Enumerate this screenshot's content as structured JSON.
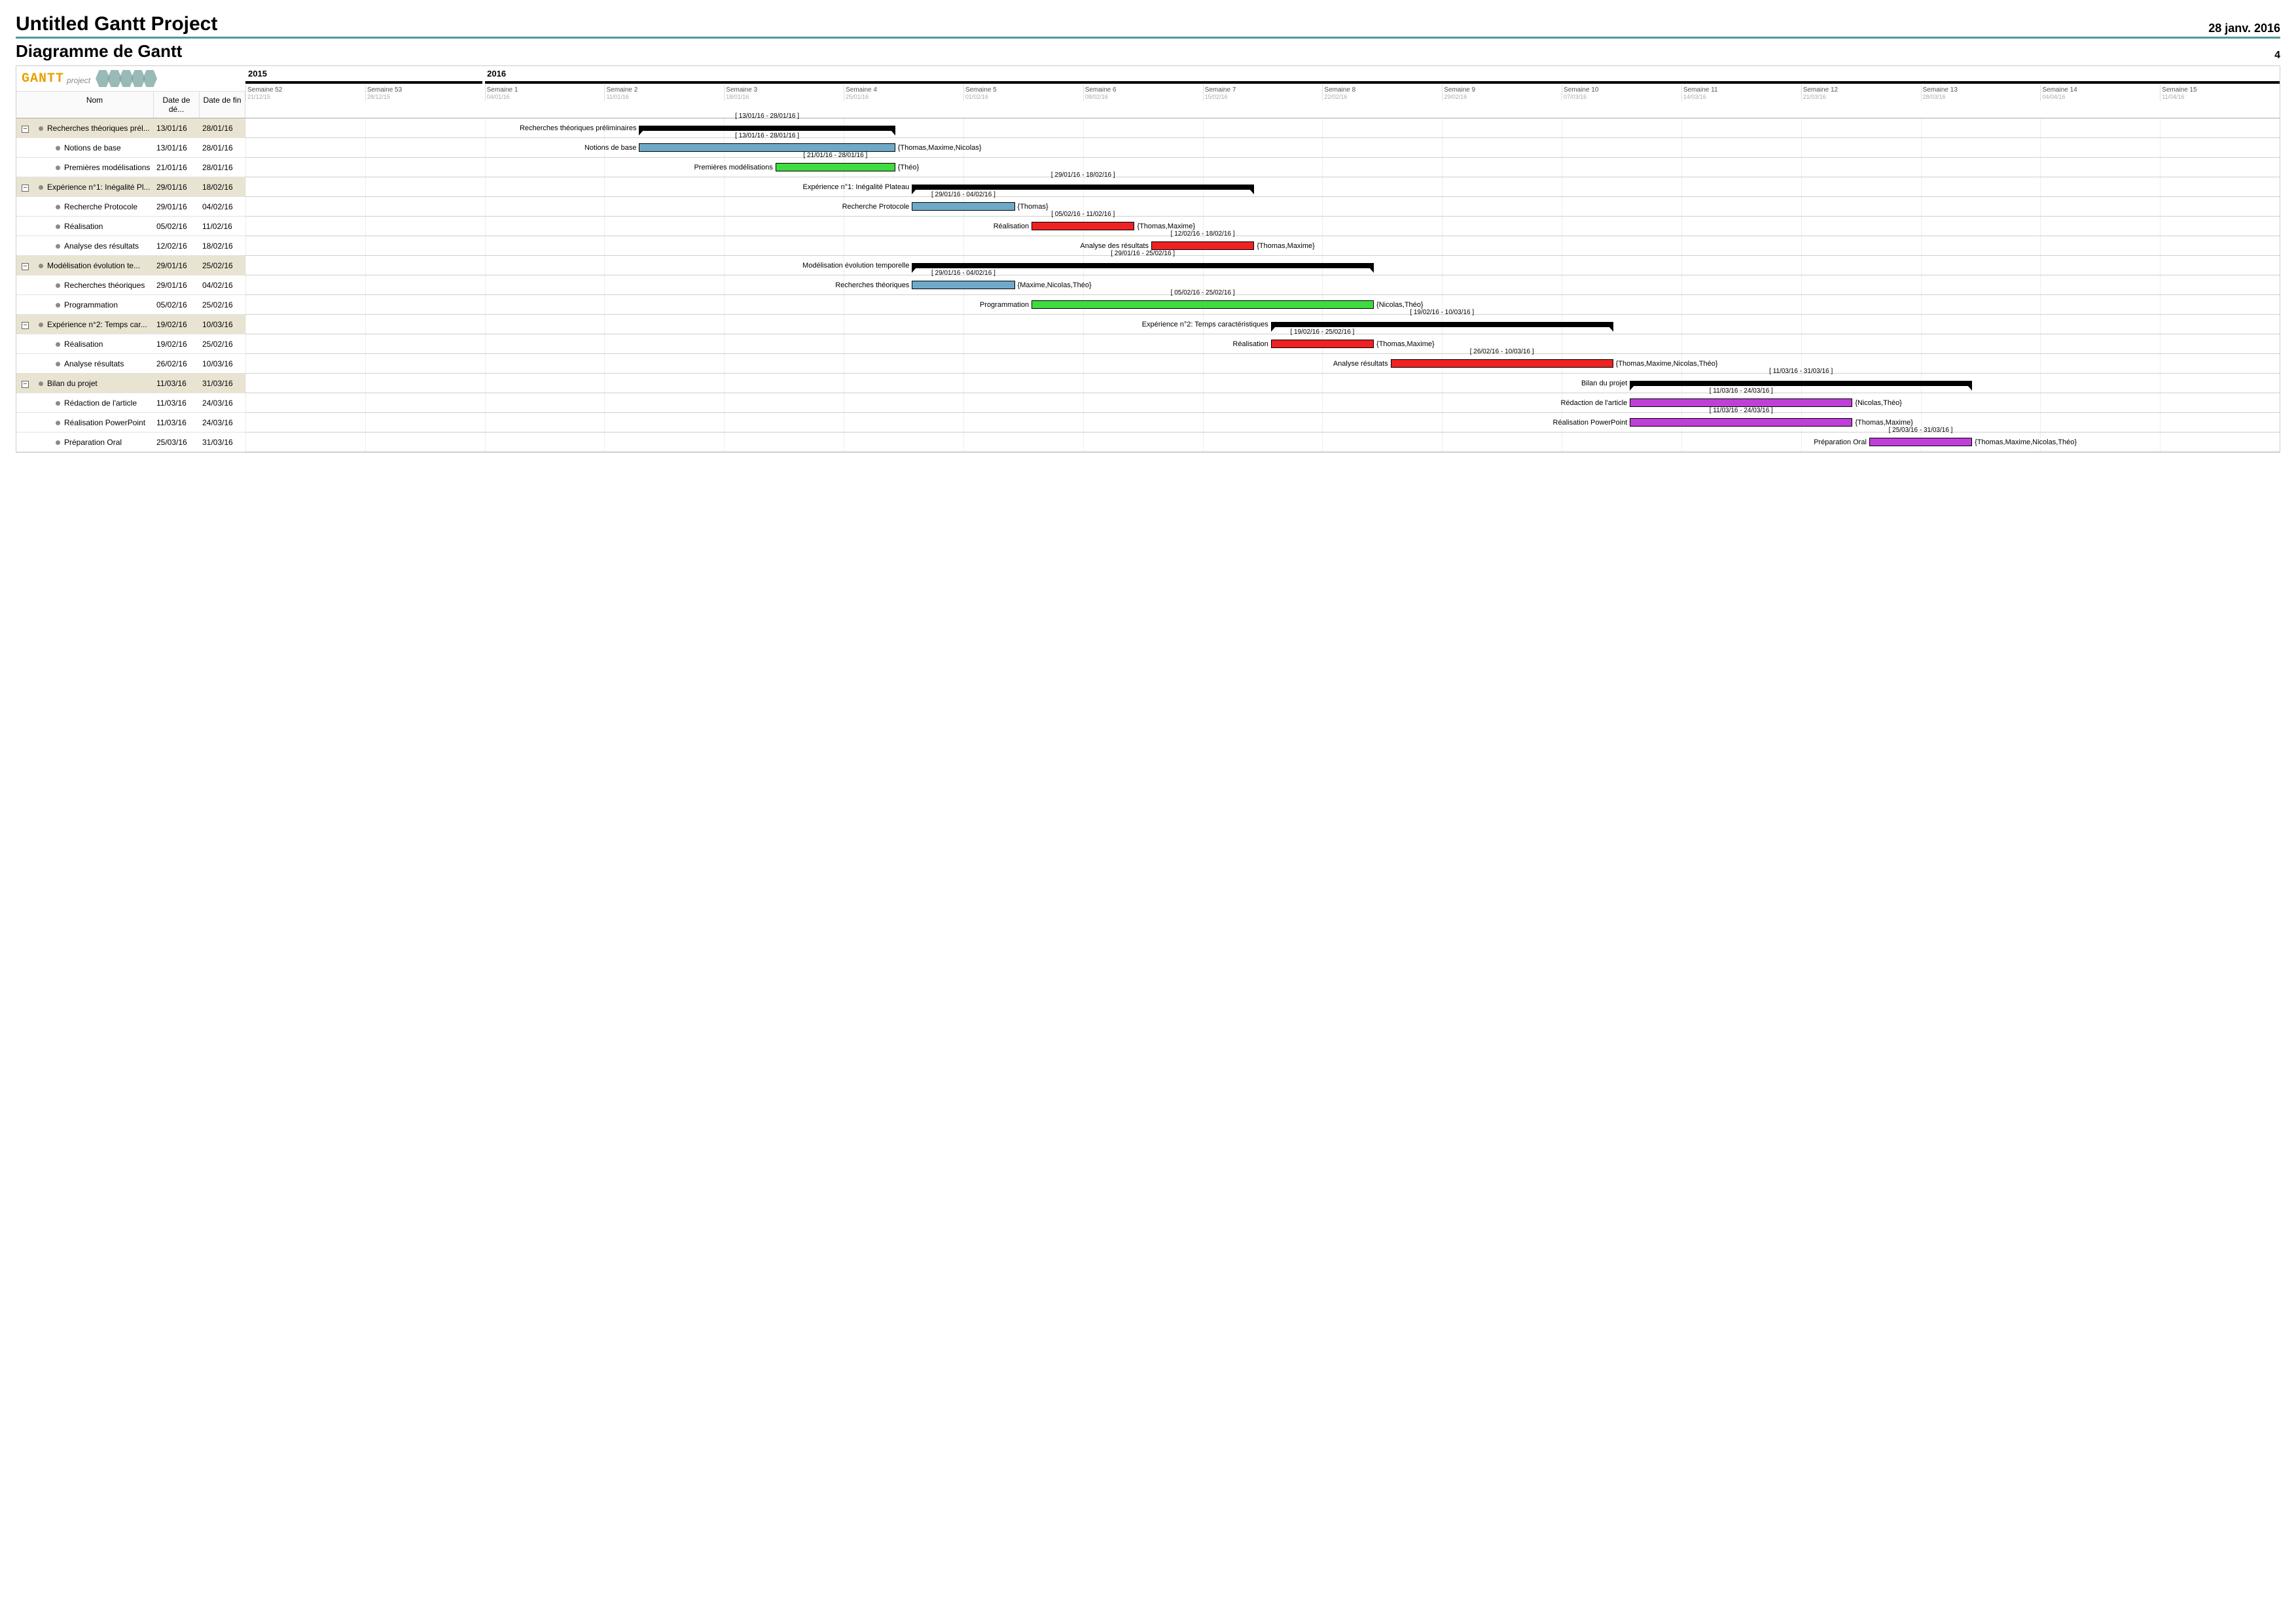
{
  "project_title": "Untitled Gantt Project",
  "project_date": "28 janv. 2016",
  "chart_title": "Diagramme de Gantt",
  "page_number": "4",
  "logo": {
    "text": "GANTT",
    "sub": "project"
  },
  "columns": {
    "name": "Nom",
    "start": "Date de dé...",
    "end": "Date de fin"
  },
  "years": {
    "y1": "2015",
    "y2": "2016"
  },
  "weeks": [
    {
      "label": "Semaine 52",
      "date": "21/12/15"
    },
    {
      "label": "Semaine 53",
      "date": "28/12/15"
    },
    {
      "label": "Semaine 1",
      "date": "04/01/16"
    },
    {
      "label": "Semaine 2",
      "date": "11/01/16"
    },
    {
      "label": "Semaine 3",
      "date": "18/01/16"
    },
    {
      "label": "Semaine 4",
      "date": "25/01/16"
    },
    {
      "label": "Semaine 5",
      "date": "01/02/16"
    },
    {
      "label": "Semaine 6",
      "date": "08/02/16"
    },
    {
      "label": "Semaine 7",
      "date": "15/02/16"
    },
    {
      "label": "Semaine 8",
      "date": "22/02/16"
    },
    {
      "label": "Semaine 9",
      "date": "29/02/16"
    },
    {
      "label": "Semaine 10",
      "date": "07/03/16"
    },
    {
      "label": "Semaine 11",
      "date": "14/03/16"
    },
    {
      "label": "Semaine 12",
      "date": "21/03/16"
    },
    {
      "label": "Semaine 13",
      "date": "28/03/16"
    },
    {
      "label": "Semaine 14",
      "date": "04/04/16"
    },
    {
      "label": "Semaine 15",
      "date": "11/04/16"
    }
  ],
  "tasks": [
    {
      "name_trunc": "Recherches théoriques prél...",
      "name_full": "Recherches théoriques préliminaires",
      "start": "13/01/16",
      "end": "28/01/16",
      "type": "group",
      "color": "",
      "start_idx": 3.29,
      "dur": 2.14,
      "res": ""
    },
    {
      "name_trunc": "Notions de base",
      "name_full": "Notions de base",
      "start": "13/01/16",
      "end": "28/01/16",
      "type": "child",
      "color": "blue",
      "start_idx": 3.29,
      "dur": 2.14,
      "res": "{Thomas,Maxime,Nicolas}"
    },
    {
      "name_trunc": "Premières modélisations",
      "name_full": "Premières modélisations",
      "start": "21/01/16",
      "end": "28/01/16",
      "type": "child",
      "color": "green",
      "start_idx": 4.43,
      "dur": 1.0,
      "res": "{Théo}"
    },
    {
      "name_trunc": "Expérience n°1: Inégalité Pl...",
      "name_full": "Expérience n°1: Inégalité Plateau",
      "start": "29/01/16",
      "end": "18/02/16",
      "type": "group",
      "color": "",
      "start_idx": 5.57,
      "dur": 2.86,
      "res": ""
    },
    {
      "name_trunc": "Recherche Protocole",
      "name_full": "Recherche Protocole",
      "start": "29/01/16",
      "end": "04/02/16",
      "type": "child",
      "color": "blue",
      "start_idx": 5.57,
      "dur": 0.86,
      "res": "{Thomas}"
    },
    {
      "name_trunc": "Réalisation",
      "name_full": "Réalisation",
      "start": "05/02/16",
      "end": "11/02/16",
      "type": "child",
      "color": "red",
      "start_idx": 6.57,
      "dur": 0.86,
      "res": "{Thomas,Maxime}"
    },
    {
      "name_trunc": "Analyse des résultats",
      "name_full": "Analyse des résultats",
      "start": "12/02/16",
      "end": "18/02/16",
      "type": "child",
      "color": "red",
      "start_idx": 7.57,
      "dur": 0.86,
      "res": "{Thomas,Maxime}"
    },
    {
      "name_trunc": "Modélisation évolution te...",
      "name_full": "Modélisation évolution temporelle",
      "start": "29/01/16",
      "end": "25/02/16",
      "type": "group",
      "color": "",
      "start_idx": 5.57,
      "dur": 3.86,
      "res": ""
    },
    {
      "name_trunc": "Recherches théoriques",
      "name_full": "Recherches théoriques",
      "start": "29/01/16",
      "end": "04/02/16",
      "type": "child",
      "color": "blue",
      "start_idx": 5.57,
      "dur": 0.86,
      "res": "{Maxime,Nicolas,Théo}"
    },
    {
      "name_trunc": "Programmation",
      "name_full": "Programmation",
      "start": "05/02/16",
      "end": "25/02/16",
      "type": "child",
      "color": "green",
      "start_idx": 6.57,
      "dur": 2.86,
      "res": "{Nicolas,Théo}"
    },
    {
      "name_trunc": "Expérience n°2: Temps car...",
      "name_full": "Expérience n°2: Temps caractéristiques",
      "start": "19/02/16",
      "end": "10/03/16",
      "type": "group",
      "color": "",
      "start_idx": 8.57,
      "dur": 2.86,
      "res": ""
    },
    {
      "name_trunc": "Réalisation",
      "name_full": "Réalisation",
      "start": "19/02/16",
      "end": "25/02/16",
      "type": "child",
      "color": "red",
      "start_idx": 8.57,
      "dur": 0.86,
      "res": "{Thomas,Maxime}"
    },
    {
      "name_trunc": "Analyse résultats",
      "name_full": "Analyse résultats",
      "start": "26/02/16",
      "end": "10/03/16",
      "type": "child",
      "color": "red",
      "start_idx": 9.57,
      "dur": 1.86,
      "res": "{Thomas,Maxime,Nicolas,Théo}"
    },
    {
      "name_trunc": "Bilan du projet",
      "name_full": "Bilan du projet",
      "start": "11/03/16",
      "end": "31/03/16",
      "type": "group",
      "color": "",
      "start_idx": 11.57,
      "dur": 2.86,
      "res": ""
    },
    {
      "name_trunc": "Rédaction de l'article",
      "name_full": "Rédaction de l'article",
      "start": "11/03/16",
      "end": "24/03/16",
      "type": "child",
      "color": "purple",
      "start_idx": 11.57,
      "dur": 1.86,
      "res": "{Nicolas,Théo}"
    },
    {
      "name_trunc": "Réalisation PowerPoint",
      "name_full": "Réalisation PowerPoint",
      "start": "11/03/16",
      "end": "24/03/16",
      "type": "child",
      "color": "purple",
      "start_idx": 11.57,
      "dur": 1.86,
      "res": "{Thomas,Maxime}"
    },
    {
      "name_trunc": "Préparation Oral",
      "name_full": "Préparation Oral",
      "start": "25/03/16",
      "end": "31/03/16",
      "type": "child",
      "color": "purple",
      "start_idx": 13.57,
      "dur": 0.86,
      "res": "{Thomas,Maxime,Nicolas,Théo}"
    }
  ],
  "chart_data": {
    "type": "gantt",
    "title": "Diagramme de Gantt",
    "x_axis": {
      "unit": "week",
      "start": "21/12/15",
      "end": "11/04/16"
    },
    "series": [
      {
        "name": "Recherches théoriques préliminaires",
        "start": "13/01/16",
        "end": "28/01/16",
        "kind": "summary"
      },
      {
        "name": "Notions de base",
        "start": "13/01/16",
        "end": "28/01/16",
        "kind": "task",
        "resources": [
          "Thomas",
          "Maxime",
          "Nicolas"
        ]
      },
      {
        "name": "Premières modélisations",
        "start": "21/01/16",
        "end": "28/01/16",
        "kind": "task",
        "resources": [
          "Théo"
        ]
      },
      {
        "name": "Expérience n°1: Inégalité Plateau",
        "start": "29/01/16",
        "end": "18/02/16",
        "kind": "summary"
      },
      {
        "name": "Recherche Protocole",
        "start": "29/01/16",
        "end": "04/02/16",
        "kind": "task",
        "resources": [
          "Thomas"
        ]
      },
      {
        "name": "Réalisation",
        "start": "05/02/16",
        "end": "11/02/16",
        "kind": "task",
        "resources": [
          "Thomas",
          "Maxime"
        ]
      },
      {
        "name": "Analyse des résultats",
        "start": "12/02/16",
        "end": "18/02/16",
        "kind": "task",
        "resources": [
          "Thomas",
          "Maxime"
        ]
      },
      {
        "name": "Modélisation évolution temporelle",
        "start": "29/01/16",
        "end": "25/02/16",
        "kind": "summary"
      },
      {
        "name": "Recherches théoriques",
        "start": "29/01/16",
        "end": "04/02/16",
        "kind": "task",
        "resources": [
          "Maxime",
          "Nicolas",
          "Théo"
        ]
      },
      {
        "name": "Programmation",
        "start": "05/02/16",
        "end": "25/02/16",
        "kind": "task",
        "resources": [
          "Nicolas",
          "Théo"
        ]
      },
      {
        "name": "Expérience n°2: Temps caractéristiques",
        "start": "19/02/16",
        "end": "10/03/16",
        "kind": "summary"
      },
      {
        "name": "Réalisation",
        "start": "19/02/16",
        "end": "25/02/16",
        "kind": "task",
        "resources": [
          "Thomas",
          "Maxime"
        ]
      },
      {
        "name": "Analyse résultats",
        "start": "26/02/16",
        "end": "10/03/16",
        "kind": "task",
        "resources": [
          "Thomas",
          "Maxime",
          "Nicolas",
          "Théo"
        ]
      },
      {
        "name": "Bilan du projet",
        "start": "11/03/16",
        "end": "31/03/16",
        "kind": "summary"
      },
      {
        "name": "Rédaction de l'article",
        "start": "11/03/16",
        "end": "24/03/16",
        "kind": "task",
        "resources": [
          "Nicolas",
          "Théo"
        ]
      },
      {
        "name": "Réalisation PowerPoint",
        "start": "11/03/16",
        "end": "24/03/16",
        "kind": "task",
        "resources": [
          "Thomas",
          "Maxime"
        ]
      },
      {
        "name": "Préparation Oral",
        "start": "25/03/16",
        "end": "31/03/16",
        "kind": "task",
        "resources": [
          "Thomas",
          "Maxime",
          "Nicolas",
          "Théo"
        ]
      }
    ]
  }
}
